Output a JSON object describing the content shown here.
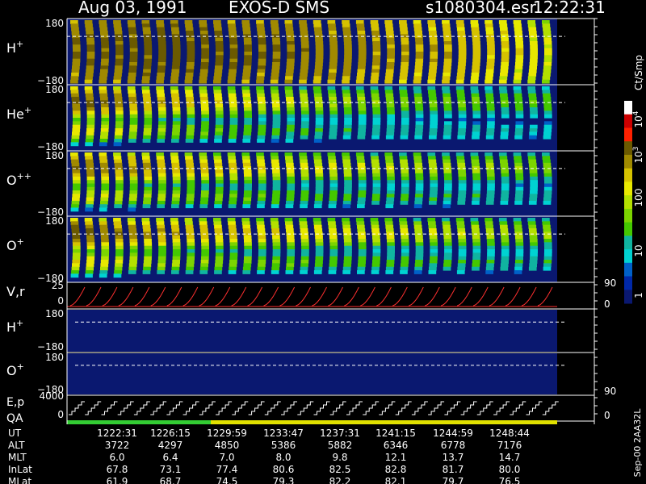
{
  "header": {
    "date": "Aug 03, 1991",
    "instrument": "EXOS-D SMS",
    "file": "s1080304.esr",
    "time": "12:22:31"
  },
  "panels": {
    "spectrograms": [
      {
        "ion_label": "H",
        "ion_sup": "+",
        "y_top": "180",
        "y_bottom": "−180"
      },
      {
        "ion_label": "He",
        "ion_sup": "+",
        "y_top": "180",
        "y_bottom": "−180"
      },
      {
        "ion_label": "O",
        "ion_sup": "++",
        "y_top": "180",
        "y_bottom": "−180"
      },
      {
        "ion_label": "O",
        "ion_sup": "+",
        "y_top": "180",
        "y_bottom": "−180"
      }
    ],
    "velocity": {
      "label": "V,r",
      "y_top": "25",
      "y_bottom": "0",
      "right_top": "90",
      "right_bottom": "0"
    },
    "low_h": {
      "ion_label": "H",
      "ion_sup": "+",
      "y_top": "180",
      "y_bottom": "−180"
    },
    "low_o": {
      "ion_label": "O",
      "ion_sup": "+",
      "y_top": "180",
      "y_bottom": "−180",
      "right_bottom": "90"
    },
    "energy": {
      "label1": "E,p",
      "label2": "QA",
      "y_top": "4000",
      "y_bottom": "0",
      "right_bottom": "0"
    }
  },
  "colorbar": {
    "units": "Ct/Smp",
    "ticks": [
      {
        "base": "10",
        "exp": "4"
      },
      {
        "base": "10",
        "exp": "3"
      },
      {
        "base": "100",
        "exp": ""
      },
      {
        "base": "10",
        "exp": ""
      },
      {
        "base": "1",
        "exp": ""
      }
    ],
    "colors": [
      "#ffffff",
      "#cc0000",
      "#ff2000",
      "#6b5a00",
      "#a08a00",
      "#d6c200",
      "#e8e800",
      "#b4e000",
      "#7cd400",
      "#44c800",
      "#10b4a0",
      "#00d2d2",
      "#0060c8",
      "#0028a8",
      "#0a1870"
    ]
  },
  "footer": {
    "version": "Sep-00 2AA32L",
    "rows": [
      {
        "label": "UT",
        "values": [
          "1222:31",
          "1226:15",
          "1229:59",
          "1233:47",
          "1237:31",
          "1241:15",
          "1244:59",
          "1248:44"
        ]
      },
      {
        "label": "ALT",
        "values": [
          "3722",
          "4297",
          "4850",
          "5386",
          "5882",
          "6346",
          "6778",
          "7176"
        ]
      },
      {
        "label": "MLT",
        "values": [
          "6.0",
          "6.4",
          "7.0",
          "8.0",
          "9.8",
          "12.1",
          "13.7",
          "14.7"
        ]
      },
      {
        "label": "InLat",
        "values": [
          "67.8",
          "73.1",
          "77.4",
          "80.6",
          "82.5",
          "82.8",
          "81.7",
          "80.0"
        ]
      },
      {
        "label": "MLat",
        "values": [
          "61.9",
          "68.7",
          "74.5",
          "79.3",
          "82.2",
          "82.1",
          "79.7",
          "76.5"
        ]
      }
    ]
  },
  "colors": {
    "background": "#000000",
    "plot_background": "#0a1870",
    "velocity_trace": "#ff3030",
    "energy_trace": "#ffffff",
    "qa_good": "#33cc33",
    "qa_warn": "#e0e000"
  },
  "chart_data": {
    "type": "heatmap",
    "title": "Aug 03, 1991   EXOS-D SMS",
    "xlabel": "UT",
    "x_ticks": [
      "1222:31",
      "1226:15",
      "1229:59",
      "1233:47",
      "1237:31",
      "1241:15",
      "1244:59",
      "1248:44"
    ],
    "ylim": [
      -180,
      180
    ],
    "color_scale": "log",
    "color_range": [
      1,
      10000
    ],
    "units": "Ct/Smp",
    "series": [
      {
        "name": "H+",
        "peak_intensity": [
          1500,
          2000,
          1800,
          1500,
          1200,
          900,
          700,
          300
        ]
      },
      {
        "name": "He+",
        "peak_intensity": [
          1800,
          900,
          500,
          300,
          200,
          150,
          120,
          100
        ]
      },
      {
        "name": "O++",
        "peak_intensity": [
          1500,
          900,
          600,
          400,
          300,
          250,
          200,
          150
        ]
      },
      {
        "name": "O+",
        "peak_intensity": [
          2000,
          1000,
          700,
          500,
          350,
          300,
          250,
          200
        ]
      }
    ],
    "scan_count": 34,
    "velocity_range": [
      0,
      25
    ],
    "energy_range": [
      0,
      4000
    ]
  }
}
